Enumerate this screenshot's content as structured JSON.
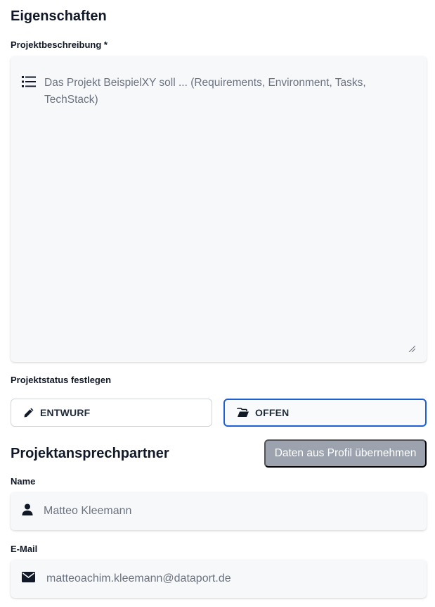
{
  "properties": {
    "title": "Eigenschaften",
    "description_label": "Projektbeschreibung *",
    "description_placeholder": "Das Projekt BeispielXY soll ... (Requirements, Environment, Tasks, TechStack)"
  },
  "status": {
    "label": "Projektstatus festlegen",
    "options": [
      {
        "label": "ENTWURF",
        "icon": "pencil-icon",
        "selected": false
      },
      {
        "label": "OFFEN",
        "icon": "folder-open-icon",
        "selected": true
      }
    ],
    "selected_border_color": "#1d5fd6"
  },
  "contact": {
    "title": "Projektansprechpartner",
    "profile_button": "Daten aus Profil übernehmen",
    "name_label": "Name",
    "name_value": "Matteo Kleemann",
    "email_label": "E-Mail",
    "email_value": "matteoachim.kleemann@dataport.de"
  }
}
